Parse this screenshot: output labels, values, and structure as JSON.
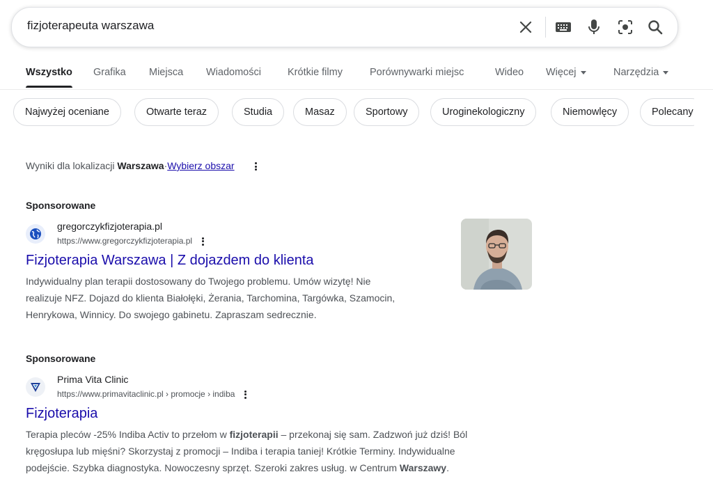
{
  "search": {
    "query": "fizjoterapeuta warszawa"
  },
  "tabs": [
    {
      "label": "Wszystko"
    },
    {
      "label": "Grafika"
    },
    {
      "label": "Miejsca"
    },
    {
      "label": "Wiadomości"
    },
    {
      "label": "Krótkie filmy"
    },
    {
      "label": "Porównywarki miejsc"
    },
    {
      "label": "Wideo"
    },
    {
      "label": "Więcej"
    },
    {
      "label": "Narzędzia"
    }
  ],
  "chips": [
    {
      "label": "Najwyżej oceniane"
    },
    {
      "label": "Otwarte teraz"
    },
    {
      "label": "Studia"
    },
    {
      "label": "Masaz"
    },
    {
      "label": "Sportowy"
    },
    {
      "label": "Uroginekologiczny"
    },
    {
      "label": "Niemowlęcy"
    },
    {
      "label": "Polecany"
    }
  ],
  "location": {
    "prefix": "Wyniki dla lokalizacji",
    "city": "Warszawa",
    "separator": "·",
    "change_link": "Wybierz obszar"
  },
  "ads": [
    {
      "label": "Sponsorowane",
      "site_name": "gregorczykfizjoterapia.pl",
      "url": "https://www.gregorczykfizjoterapia.pl",
      "title": "Fizjoterapia Warszawa | Z dojazdem do klienta",
      "desc_lines": [
        "Indywidualny plan terapii dostosowany do Twojego problemu. Umów wizytę! Nie",
        "realizuje NFZ. Dojazd do klienta Białołęki, Żerania, Tarchomina, Targówka, Szamocin,",
        "Henrykowa, Winnicy. Do swojego gabinetu. Zapraszam sedrecznie."
      ]
    },
    {
      "label": "Sponsorowane",
      "site_name": "Prima Vita Clinic",
      "url": "https://www.primavitaclinic.pl › promocje › indiba",
      "title": "Fizjoterapia",
      "desc": {
        "l1_a": "Terapia pleców -25% Indiba Activ to przełom w ",
        "l1_b": "fizjoterapii",
        "l1_c": " – przekonaj się sam. Zadzwoń już dziś! Ból",
        "l2": "kręgosłupa lub mięśni? Skorzystaj z promocji – Indiba i terapia taniej! Krótkie Terminy. Indywidualne",
        "l3_a": "podejście. Szybka diagnostyka. Nowoczesny sprzęt. Szeroki zakres usług. w Centrum ",
        "l3_b": "Warszawy",
        "l3_c": "."
      }
    }
  ],
  "colors": {
    "link": "#1a0dab",
    "text": "#202124",
    "muted": "#4d5156"
  }
}
